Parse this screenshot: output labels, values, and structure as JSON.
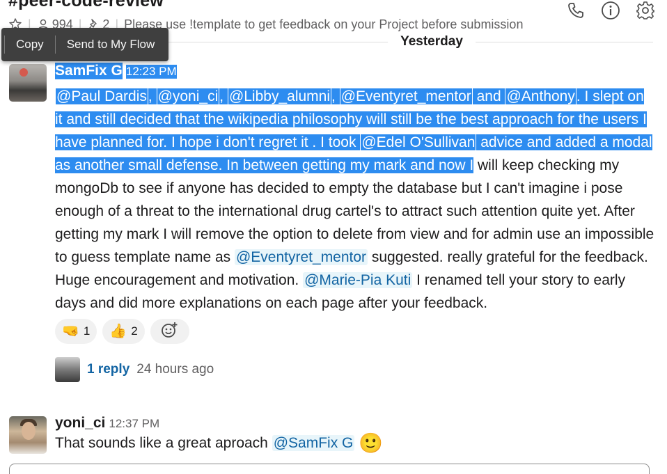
{
  "channel": {
    "title": "#peer-code-review",
    "member_count": "994",
    "pinned_count": "2",
    "topic": "Please use !template to get feedback on your Project before submission"
  },
  "day_divider": "Yesterday",
  "context_menu": {
    "copy_label": "Copy",
    "flow_label": "Send to My Flow"
  },
  "messages": [
    {
      "author": "SamFix G",
      "time": "12:23 PM",
      "sel": {
        "m1": "@Paul Dardis",
        "c1": ",",
        "m2": "@yoni_ci",
        "c2": ",",
        "m3": "@Libby_alumni",
        "c3": ",",
        "m4": "@Eventyret_mentor",
        "and": "and",
        "m5": "@Anthony",
        "t1": ". I slept on it and still decided that the wikipedia philosophy will still be the best approach for the users I have planned for. I hope i don't regret it . I took",
        "m6": "@Edel O'Sullivan",
        "t2": " advice and added a modal as another small defense. In between getting my mark and now I"
      },
      "rest1": " will keep checking my mongoDb to see if anyone has decided to empty the database but I can't imagine i pose enough of a threat to the international drug cartel's to attract such attention quite yet. After getting my mark I will remove the option to delete from view and for admin use an impossible to guess template name as ",
      "m7": "@Eventyret_mentor",
      "rest2": " suggested. really grateful for the feedback. Huge encouragement and motivation.",
      "m8": "@Marie-Pia Kuti",
      "rest3": " I renamed  tell your story to early days and did more explanations on each page after your feedback.",
      "reactions": [
        {
          "emoji": "🤜",
          "count": "1"
        },
        {
          "emoji": "👍",
          "count": "2"
        }
      ],
      "thread": {
        "reply_count": "1 reply",
        "last_reply": "24 hours ago"
      }
    },
    {
      "author": "yoni_ci",
      "time": "12:37 PM",
      "text": "That sounds like a great aproach",
      "mention": "@SamFix G",
      "emoji": "🙂"
    }
  ],
  "icons": {
    "star": "star-icon",
    "members": "person-icon",
    "pins": "pin-icon",
    "call": "phone-icon",
    "info": "info-icon",
    "settings": "gear-icon",
    "add_reaction": "add-reaction-icon"
  }
}
